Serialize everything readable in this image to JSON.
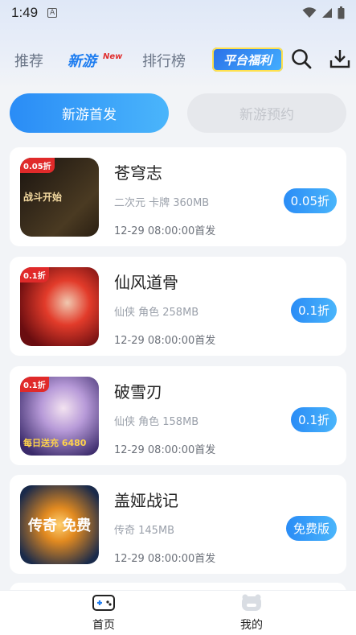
{
  "status": {
    "time": "1:49",
    "notif_glyph": "A"
  },
  "nav": {
    "tabs": [
      {
        "label": "推荐",
        "active": false
      },
      {
        "label": "新游",
        "active": true,
        "badge": "New"
      },
      {
        "label": "排行榜",
        "active": false
      }
    ],
    "welfare_label": "平台福利",
    "search_icon": "search-icon",
    "download_icon": "download-icon"
  },
  "segments": {
    "active": "新游首发",
    "inactive": "新游预约"
  },
  "games": [
    {
      "title": "苍穹志",
      "meta": "二次元 卡牌 360MB",
      "date": "12-29 08:00:00首发",
      "badge": "0.05折",
      "thumb_tag": "0.05折",
      "thumb_text": "战斗开始",
      "colors": [
        "#1a1410",
        "#4a3a22"
      ]
    },
    {
      "title": "仙风道骨",
      "meta": "仙侠 角色 258MB",
      "date": "12-29 08:00:00首发",
      "badge": "0.1折",
      "thumb_tag": "0.1折",
      "thumb_text": "",
      "colors": [
        "#6a0d10",
        "#e23b2a"
      ]
    },
    {
      "title": "破雪刃",
      "meta": "仙侠 角色 158MB",
      "date": "12-29 08:00:00首发",
      "badge": "0.1折",
      "thumb_tag": "0.1折",
      "thumb_text": "每日送充 6480",
      "colors": [
        "#3a2a6a",
        "#b79ad8"
      ]
    },
    {
      "title": "盖娅战记",
      "meta": "传奇 145MB",
      "date": "12-29 08:00:00首发",
      "badge": "免费版",
      "thumb_tag": "",
      "thumb_text": "传奇 免费",
      "colors": [
        "#1a2a4a",
        "#e28a20"
      ]
    }
  ],
  "tabbar": {
    "items": [
      {
        "label": "首页",
        "icon": "gamepad-icon",
        "active": true
      },
      {
        "label": "我的",
        "icon": "profile-icon",
        "active": false
      }
    ]
  }
}
